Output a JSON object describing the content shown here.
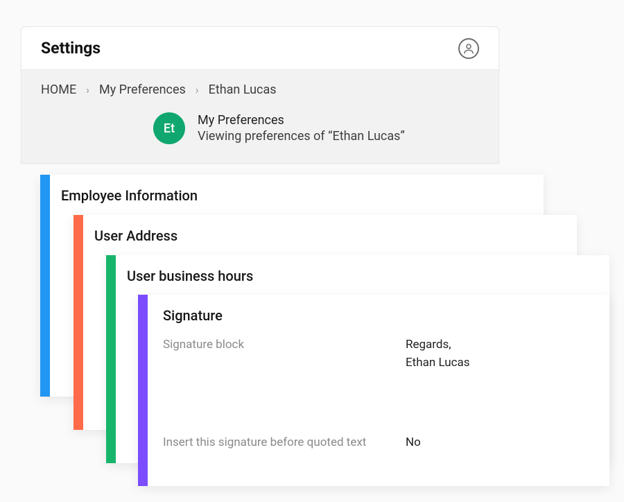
{
  "pageTitle": "Settings",
  "breadcrumb": {
    "home": "HOME",
    "pref": "My Preferences",
    "user": "Ethan Lucas"
  },
  "avatar": {
    "initials": "Et",
    "color": "#0fa76f"
  },
  "subheader": {
    "title": "My Preferences",
    "desc": "Viewing preferences of “Ethan Lucas”"
  },
  "cards": {
    "employee": {
      "title": "Employee Information",
      "barColor": "#2196f3"
    },
    "address": {
      "title": "User Address",
      "barColor": "#ff6b4a"
    },
    "hours": {
      "title": "User business hours",
      "barColor": "#17b56b"
    },
    "signature": {
      "title": "Signature",
      "barColor": "#7c4dff",
      "fields": {
        "blockLabel": "Signature block",
        "blockValue": "Regards,\nEthan Lucas",
        "insertLabel": "Insert this signature before quoted text",
        "insertValue": "No"
      }
    }
  }
}
